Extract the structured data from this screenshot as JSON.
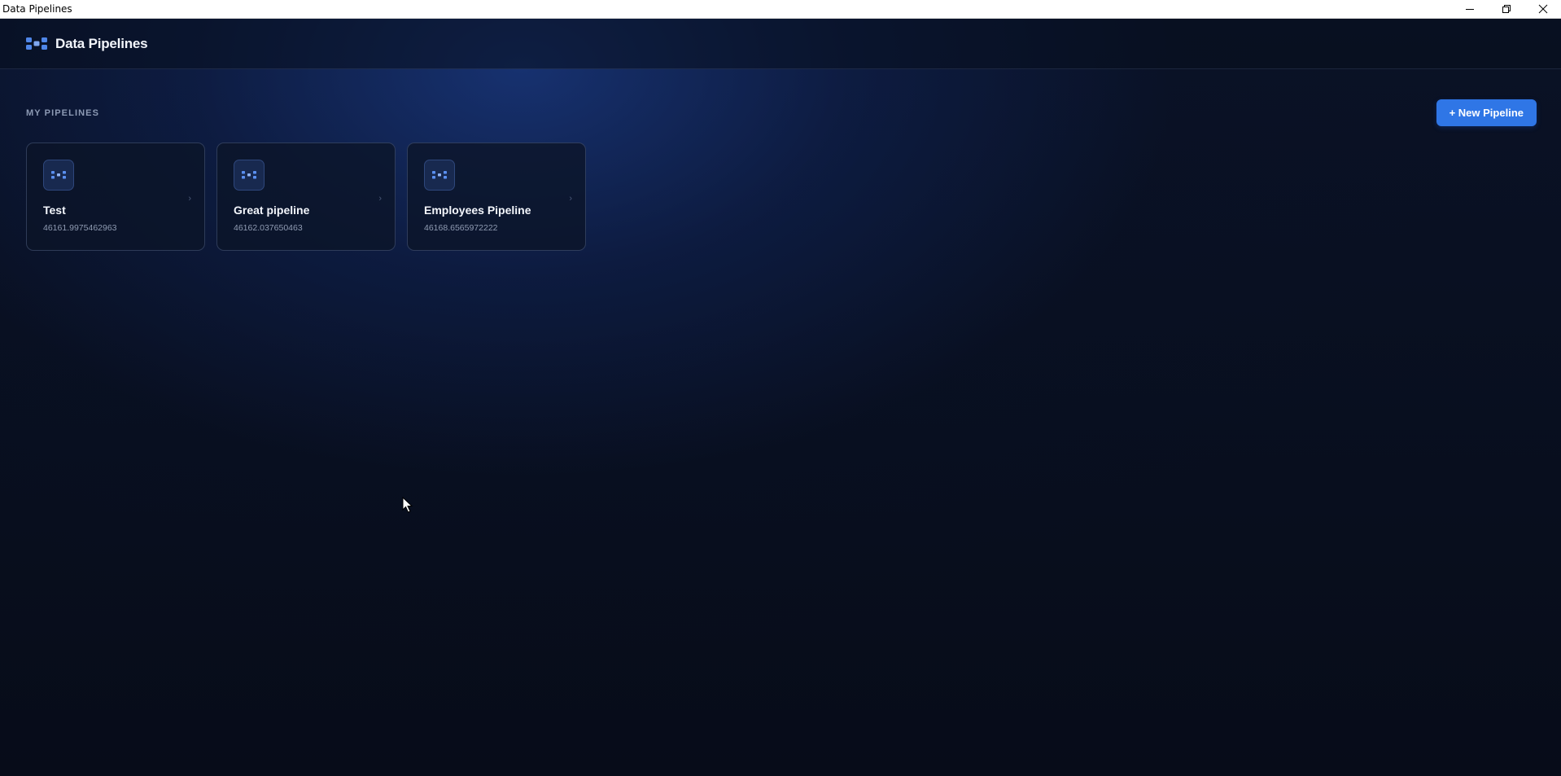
{
  "window": {
    "title": "Data Pipelines"
  },
  "header": {
    "title": "Data Pipelines",
    "logo_icon": "pipeline-nodes-icon"
  },
  "section": {
    "title": "MY PIPELINES",
    "new_button_label": "+ New Pipeline"
  },
  "pipelines": [
    {
      "name": "Test",
      "meta": "46161.9975462963"
    },
    {
      "name": "Great pipeline",
      "meta": "46162.037650463"
    },
    {
      "name": "Employees Pipeline",
      "meta": "46168.6565972222"
    }
  ],
  "colors": {
    "accent": "#2f76e6",
    "background": "#070c19",
    "card_border": "#3a4a70"
  }
}
